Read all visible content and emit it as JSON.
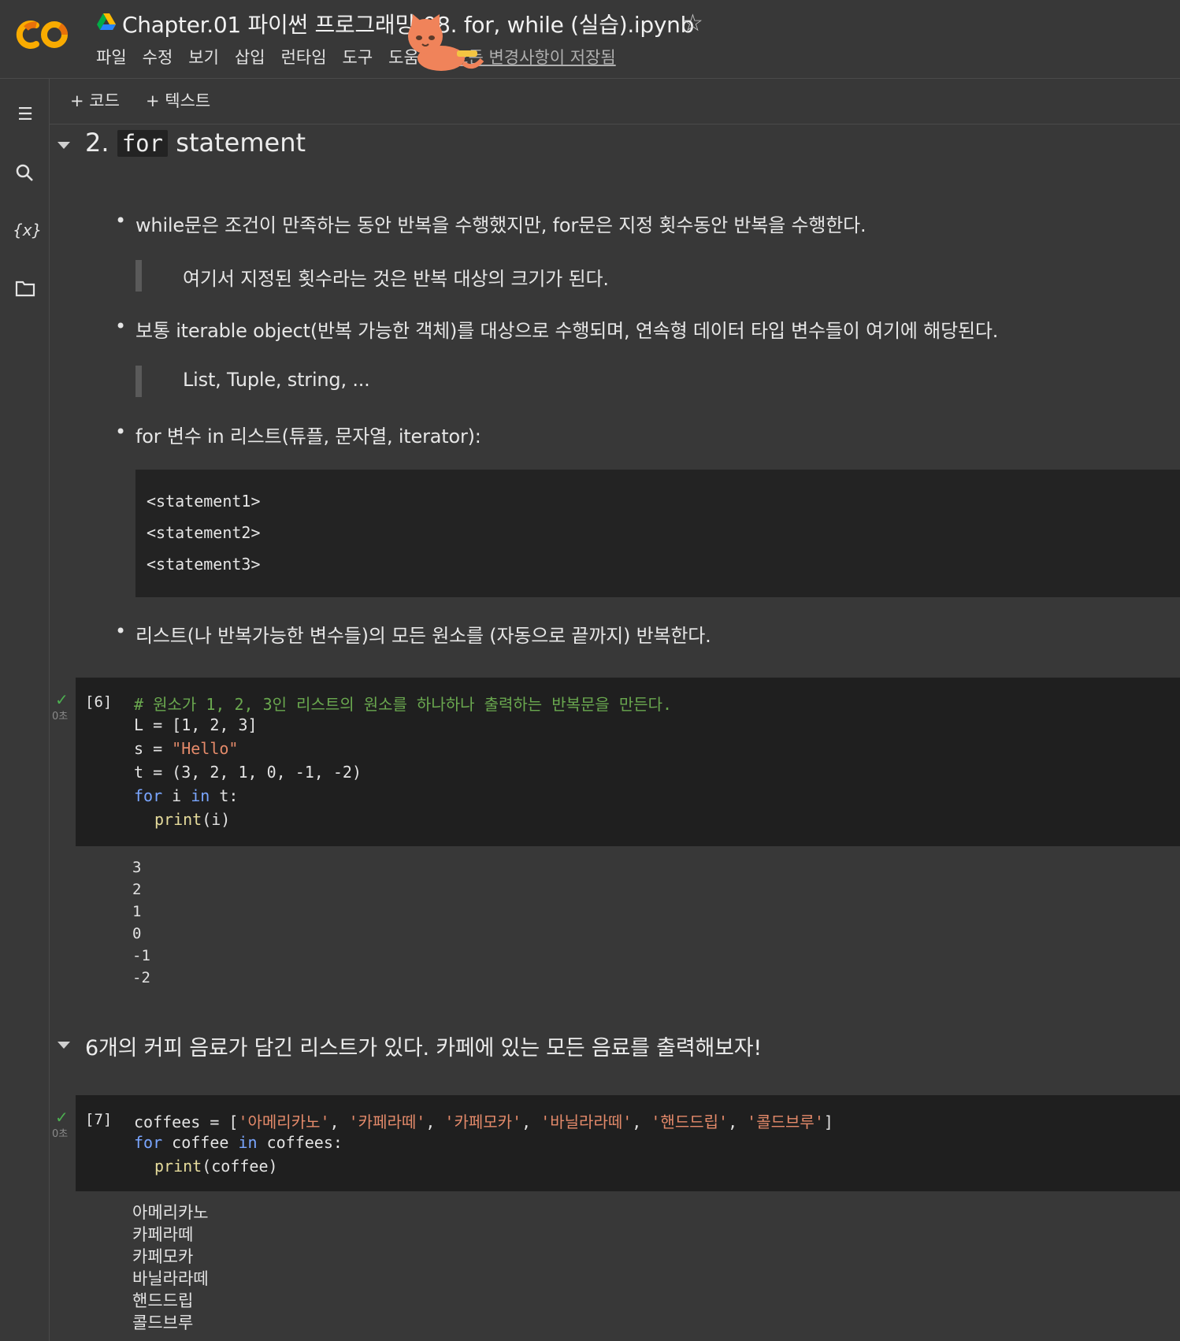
{
  "header": {
    "title": "Chapter.01 파이썬 프로그래밍-08. for, while (실습).ipynb",
    "menu": [
      "파일",
      "수정",
      "보기",
      "삽입",
      "런타임",
      "도구",
      "도움말"
    ],
    "save_status": "모든 변경사항이 저장됨"
  },
  "toolbar": {
    "add_code": "+ 코드",
    "add_text": "+ 텍스트"
  },
  "section1": {
    "title_num": "2.",
    "title_code": "for",
    "title_rest": "statement",
    "bullet1": "while문은 조건이 만족하는 동안 반복을 수행했지만, for문은 지정 횟수동안 반복을 수행한다.",
    "quote1": "여기서 지정된 횟수라는 것은 반복 대상의 크기가 된다.",
    "bullet2": "보통 iterable object(반복 가능한 객체)를 대상으로 수행되며, 연속형 데이터 타입 변수들이 여기에 해당된다.",
    "quote2": "List, Tuple, string, ...",
    "bullet3": "for 변수 in 리스트(튜플, 문자열, iterator):",
    "code_block": [
      "<statement1>",
      "<statement2>",
      "<statement3>"
    ],
    "bullet4": "리스트(나 반복가능한 변수들)의 모든 원소를 (자동으로 끝까지) 반복한다."
  },
  "cell6": {
    "count": "[6]",
    "time": "0초",
    "comment": "# 원소가 1, 2, 3인 리스트의 원소를 하나하나 출력하는 반복문을 만든다.",
    "line_L": "L = [1, 2, 3]",
    "line_s_var": "s = ",
    "line_s_str": "\"Hello\"",
    "line_t": "t = (3, 2, 1, 0, -1, -2)",
    "for_kw": "for",
    "for_var": " i ",
    "in_kw": "in",
    "for_rest": " t:",
    "print_fn": "print",
    "print_arg": "(i)",
    "output": [
      "3",
      "2",
      "1",
      "0",
      "-1",
      "-2"
    ]
  },
  "section2": {
    "title": "6개의 커피 음료가 담긴 리스트가 있다. 카페에 있는 모든 음료를 출력해보자!"
  },
  "cell7": {
    "count": "[7]",
    "time": "0초",
    "assign": "coffees = [",
    "items": [
      "'아메리카노'",
      "'카페라떼'",
      "'카페모카'",
      "'바닐라라떼'",
      "'핸드드립'",
      "'콜드브루'"
    ],
    "sep": ", ",
    "close": "]",
    "for_kw": "for",
    "for_var": " coffee ",
    "in_kw": "in",
    "for_rest": " coffees:",
    "print_fn": "print",
    "print_arg": "(coffee)",
    "output": [
      "아메리카노",
      "카페라떼",
      "카페모카",
      "바닐라라떼",
      "핸드드립",
      "콜드브루"
    ]
  }
}
